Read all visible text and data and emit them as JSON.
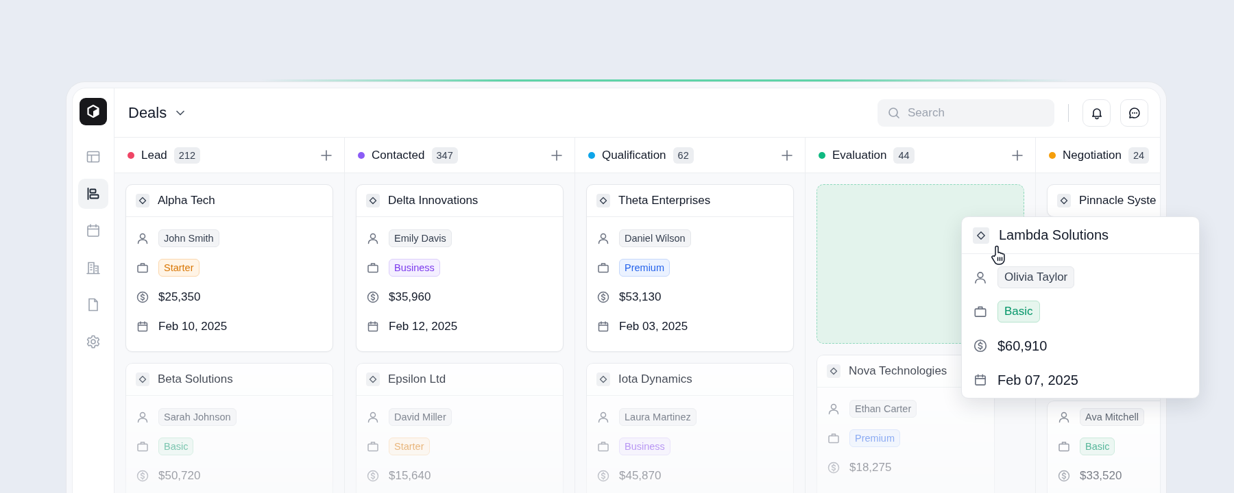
{
  "sidebar": {
    "items": [
      {
        "kind": "layout",
        "selected": false
      },
      {
        "kind": "board",
        "selected": true
      },
      {
        "kind": "calendar",
        "selected": false
      },
      {
        "kind": "building",
        "selected": false
      },
      {
        "kind": "file",
        "selected": false
      },
      {
        "kind": "settings",
        "selected": false
      }
    ]
  },
  "header": {
    "title": "Deals",
    "search": {
      "placeholder": "Search"
    }
  },
  "columns": [
    {
      "name": "Lead",
      "count": "212",
      "color": "#ef4565",
      "add_button": true,
      "items": [
        {
          "kind": "card",
          "dimmed": false,
          "title": "Alpha Tech",
          "contact": "John Smith",
          "plan": {
            "label": "Starter",
            "kind": "starter"
          },
          "amount": "$25,350",
          "date": "Feb 10, 2025"
        },
        {
          "kind": "card",
          "dimmed": true,
          "title": "Beta Solutions",
          "contact": "Sarah Johnson",
          "plan": {
            "label": "Basic",
            "kind": "basic"
          },
          "amount": "$50,720"
        }
      ]
    },
    {
      "name": "Contacted",
      "count": "347",
      "color": "#8b5cf6",
      "add_button": true,
      "items": [
        {
          "kind": "card",
          "dimmed": false,
          "title": "Delta Innovations",
          "contact": "Emily Davis",
          "plan": {
            "label": "Business",
            "kind": "business"
          },
          "amount": "$35,960",
          "date": "Feb 12, 2025"
        },
        {
          "kind": "card",
          "dimmed": true,
          "title": "Epsilon Ltd",
          "contact": "David Miller",
          "plan": {
            "label": "Starter",
            "kind": "starter"
          },
          "amount": "$15,640"
        }
      ]
    },
    {
      "name": "Qualification",
      "count": "62",
      "color": "#0ea5e9",
      "add_button": true,
      "items": [
        {
          "kind": "card",
          "dimmed": false,
          "title": "Theta Enterprises",
          "contact": "Daniel Wilson",
          "plan": {
            "label": "Premium",
            "kind": "premium"
          },
          "amount": "$53,130",
          "date": "Feb 03, 2025"
        },
        {
          "kind": "card",
          "dimmed": true,
          "title": "Iota Dynamics",
          "contact": "Laura Martinez",
          "plan": {
            "label": "Business",
            "kind": "business"
          },
          "amount": "$45,870"
        }
      ]
    },
    {
      "name": "Evaluation",
      "count": "44",
      "color": "#10b981",
      "add_button": true,
      "items": [
        {
          "kind": "placeholder"
        },
        {
          "kind": "card",
          "dimmed": true,
          "title": "Nova Technologies",
          "contact": "Ethan Carter",
          "plan": {
            "label": "Premium",
            "kind": "premium"
          },
          "amount": "$18,275"
        }
      ]
    },
    {
      "name": "Negotiation",
      "count": "24",
      "color": "#f59e0b",
      "add_button": false,
      "items": [
        {
          "kind": "card",
          "dimmed": false,
          "title": "Pinnacle Syste"
        },
        {
          "kind": "card",
          "dimmed": true,
          "contact": "Ava Mitchell",
          "plan": {
            "label": "Basic",
            "kind": "basic"
          },
          "amount": "$33,520"
        }
      ]
    }
  ],
  "dragged_card": {
    "title": "Lambda Solutions",
    "contact": "Olivia Taylor",
    "plan": {
      "label": "Basic",
      "kind": "basic"
    },
    "amount": "$60,910",
    "date": "Feb 07, 2025"
  }
}
